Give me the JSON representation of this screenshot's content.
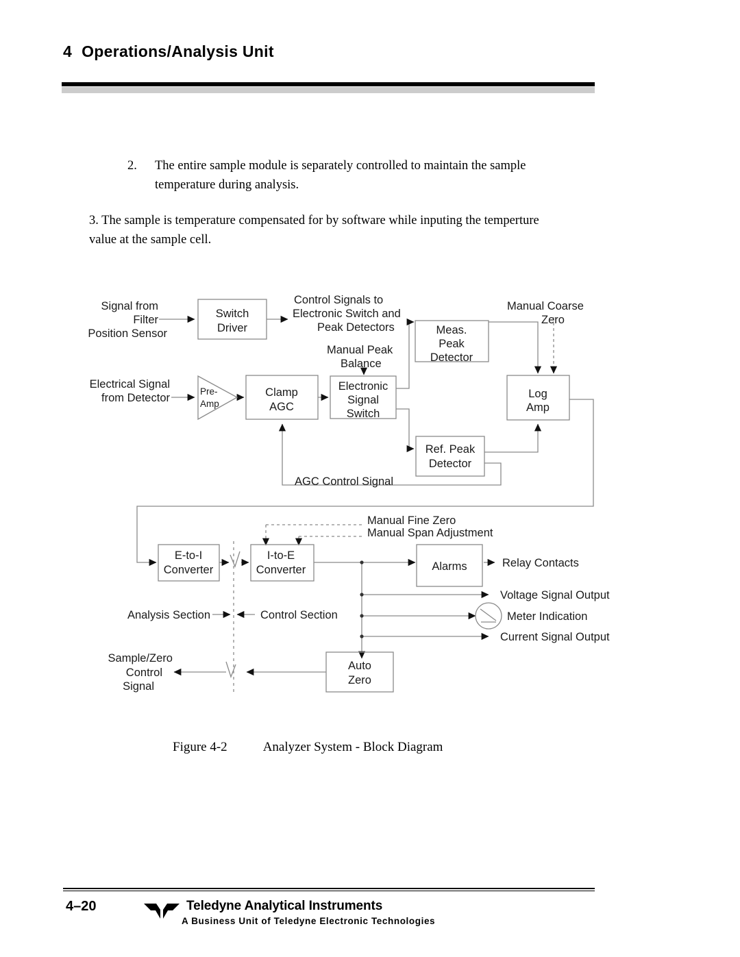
{
  "header": {
    "chapter_number": "4",
    "chapter_title": "Operations/Analysis Unit"
  },
  "body": {
    "item2_marker": "2.",
    "item2_text": "The entire sample module is separately controlled to maintain the sample temperature during analysis.",
    "item3_text": "3. The sample is temperature compensated for by software while inputing the temperture value at the sample cell."
  },
  "figure": {
    "caption_label": "Figure 4-2",
    "caption_title": "Analyzer System - Block Diagram",
    "blocks": {
      "switch_driver": "Switch\nDriver",
      "switch_driver_l1": "Switch",
      "switch_driver_l2": "Driver",
      "pre_amp_l1": "Pre-",
      "pre_amp_l2": "Amp",
      "clamp_agc_l1": "Clamp",
      "clamp_agc_l2": "AGC",
      "electronic_signal_switch_l1": "Electronic",
      "electronic_signal_switch_l2": "Signal",
      "electronic_signal_switch_l3": "Switch",
      "meas_peak_detector_l1": "Meas.",
      "meas_peak_detector_l2": "Peak",
      "meas_peak_detector_l3": "Detector",
      "ref_peak_detector_l1": "Ref.   Peak",
      "ref_peak_detector_l2": "Detector",
      "log_amp_l1": "Log",
      "log_amp_l2": "Amp",
      "e_to_i_l1": "E-to-I",
      "e_to_i_l2": "Converter",
      "i_to_e_l1": "I-to-E",
      "i_to_e_l2": "Converter",
      "alarms": "Alarms",
      "auto_zero_l1": "Auto",
      "auto_zero_l2": "Zero"
    },
    "labels": {
      "signal_from_filter_l1": "Signal    from",
      "signal_from_filter_l2": "Filter",
      "signal_from_filter_l3": "Position    Sensor",
      "control_signals_l1": "Control    Signals    to",
      "control_signals_l2": "Electronic    Switch    and",
      "control_signals_l3": "Peak    Detectors",
      "manual_coarse_zero_l1": "Manual    Coarse",
      "manual_coarse_zero_l2": "Zero",
      "manual_peak_balance_l1": "Manual    Peak",
      "manual_peak_balance_l2": "Balance",
      "electrical_signal_l1": "Electrical    Signal",
      "electrical_signal_l2": "from    Detector",
      "agc_control_signal": "AGC    Control    Signal",
      "manual_fine_zero": "Manual   Fine   Zero",
      "manual_span_adjustment": "Manual   Span   Adjustment",
      "relay_contacts": "Relay    Contacts",
      "voltage_signal_output": "Voltage    Signal    Output",
      "meter_indication": "Meter    Indication",
      "current_signal_output": "Current    Signal    Output",
      "analysis_section": "Analysis    Section",
      "control_section": "Control    Section",
      "sample_zero_l1": "Sample/Zero",
      "sample_zero_l2": "Control",
      "sample_zero_l3": "Signal"
    }
  },
  "footer": {
    "page_number": "4–20",
    "company": "Teledyne Analytical Instruments",
    "company_sub": "A Business Unit of Teledyne Electronic Technologies"
  },
  "colors": {
    "rule_black": "#000000",
    "rule_gray": "#cccccc",
    "box_stroke": "#8a8a8a",
    "wire": "#8a8a8a",
    "text": "#1a1a1a"
  }
}
